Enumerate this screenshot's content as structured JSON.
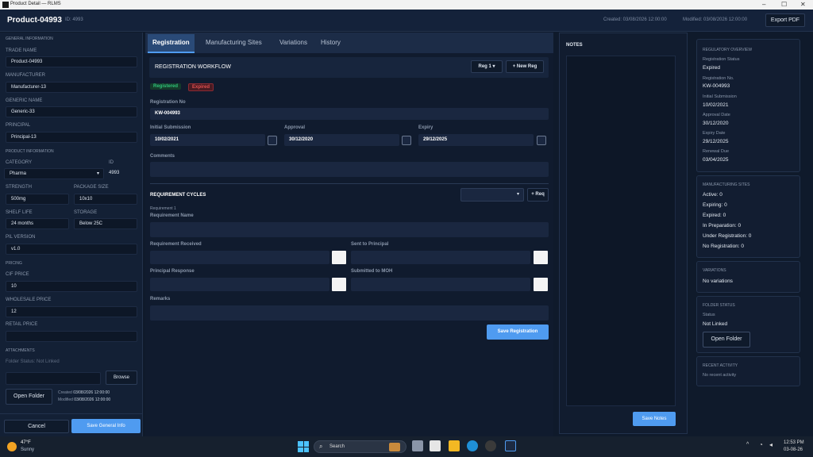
{
  "window": {
    "title": "Product Detail — RLMS",
    "controls": [
      "–",
      "☐",
      "✕"
    ]
  },
  "header": {
    "title": "Product-04993",
    "id": "ID: 4993",
    "created": "Created: 03/08/2026 12:00:00",
    "modified": "Modified: 03/08/2026 12:00:00",
    "export": "Export PDF"
  },
  "sidebar": {
    "general_section": "GENERAL INFORMATION",
    "trade_name_label": "TRADE NAME",
    "trade_name": "Product-04993",
    "manufacturer_label": "MANUFACTURER",
    "manufacturer": "Manufacturer-13",
    "generic_label": "GENERIC NAME",
    "generic": "Generic-33",
    "principal_label": "PRINCIPAL",
    "principal": "Principal-13",
    "product_section": "PRODUCT INFORMATION",
    "category_label": "CATEGORY",
    "category": "Pharma",
    "id_label": "ID",
    "id_value": "4993",
    "strength_label": "STRENGTH",
    "strength": "500mg",
    "package_label": "PACKAGE SIZE",
    "package": "10x10",
    "shelf_label": "SHELF LIFE",
    "shelf": "24 months",
    "storage_label": "STORAGE",
    "storage": "Below 25C",
    "pil_label": "PIL VERSION",
    "pil": "v1.0",
    "pricing_section": "PRICING",
    "cif_label": "CIF PRICE",
    "cif": "10",
    "wholesale_label": "WHOLESALE PRICE",
    "wholesale": "12",
    "retail_label": "RETAIL PRICE",
    "retail": "",
    "attachments_section": "ATTACHMENTS",
    "folder_status": "Folder Status: Not Linked",
    "browse": "Browse",
    "open_folder": "Open Folder",
    "created_label": "Created",
    "created": "03/08/2026 12:00:00",
    "modified_label": "Modified",
    "modified": "03/08/2026 12:00:00",
    "cancel": "Cancel",
    "save": "Save General Info"
  },
  "tabs": [
    "Registration",
    "Manufacturing Sites",
    "Variations",
    "History"
  ],
  "registration": {
    "workflow_title": "REGISTRATION WORKFLOW",
    "reg_select": "Reg 1",
    "new_reg": "+ New Reg",
    "badge_registered": "Registered",
    "badge_expired": "Expired",
    "reg_no_label": "Registration No",
    "reg_no": "KW-004993",
    "initial_label": "Initial Submission",
    "initial": "10/02/2021",
    "approval_label": "Approval",
    "approval": "30/12/2020",
    "expiry_label": "Expiry",
    "expiry": "29/12/2025",
    "comments_label": "Comments",
    "cycles_title": "REQUIREMENT CYCLES",
    "req_btn": "+ Req",
    "req_index": "Requirement 1",
    "req_name_label": "Requirement Name",
    "received_label": "Requirement Received",
    "sent_label": "Sent to Principal",
    "response_label": "Principal Response",
    "moh_label": "Submitted to MOH",
    "remarks_label": "Remarks",
    "save": "Save Registration"
  },
  "notes": {
    "title": "NOTES",
    "save": "Save Notes"
  },
  "overview": {
    "title": "REGULATORY OVERVIEW",
    "status_label": "Registration Status",
    "status": "Expired",
    "regno_label": "Registration No.",
    "regno": "KW-004993",
    "initial_label": "Initial Submission",
    "initial": "10/02/2021",
    "approval_label": "Approval Date",
    "approval": "30/12/2020",
    "expiry_label": "Expiry Date",
    "expiry": "29/12/2025",
    "renewal_label": "Renewal Due",
    "renewal": "03/04/2025"
  },
  "mfg": {
    "title": "MANUFACTURING SITES",
    "active": "Active: 0",
    "expiring": "Expiring: 0",
    "expired": "Expired: 0",
    "prep": "In Preparation: 0",
    "under": "Under Registration: 0",
    "none": "No Registration: 0"
  },
  "variations": {
    "title": "VARIATIONS",
    "text": "No variations"
  },
  "folder": {
    "title": "FOLDER STATUS",
    "status_label": "Status",
    "status": "Not Linked",
    "open": "Open Folder"
  },
  "activity": {
    "title": "RECENT ACTIVITY",
    "text": "No recent activity"
  },
  "taskbar": {
    "temp": "47°F",
    "weather": "Sunny",
    "search": "Search",
    "time": "12:53 PM",
    "date": "03-08-26"
  }
}
